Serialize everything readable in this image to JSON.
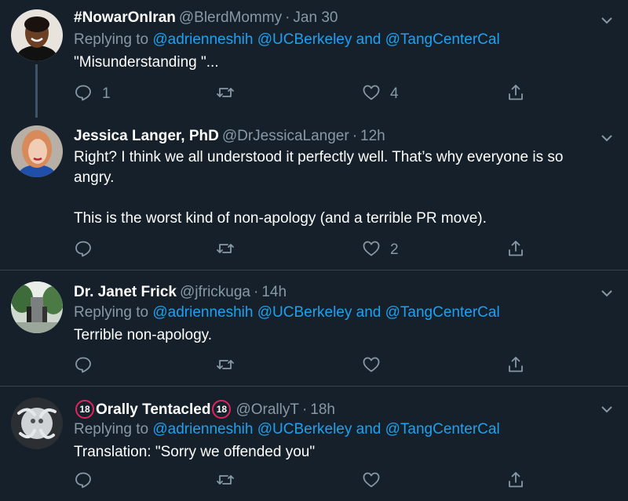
{
  "tweets": [
    {
      "name": "#NowarOnIran",
      "handle": "@BlerdMommy",
      "time": "Jan 30",
      "replying_prefix": "Replying to",
      "replying_to": [
        "@adrienneshih",
        "@UCBerkeley",
        "@TangCenterCal"
      ],
      "replying_and": "and",
      "text": "\"Misunderstanding \"...",
      "replies": "1",
      "likes": "4"
    },
    {
      "name": "Jessica Langer, PhD",
      "handle": "@DrJessicaLanger",
      "time": "12h",
      "text_line1": "Right? I think we all understood it perfectly well. That’s why everyone is so angry.",
      "text_line2": "This is the worst kind of non-apology (and a terrible PR move).",
      "likes": "2"
    },
    {
      "name": "Dr. Janet Frick",
      "handle": "@jfrickuga",
      "time": "14h",
      "replying_prefix": "Replying to",
      "replying_to": [
        "@adrienneshih",
        "@UCBerkeley",
        "@TangCenterCal"
      ],
      "replying_and": "and",
      "text": "Terrible non-apology."
    },
    {
      "name": "Orally Tentacled",
      "badge": "18",
      "handle": "@OrallyT",
      "time": "18h",
      "replying_prefix": "Replying to",
      "replying_to": [
        "@adrienneshih",
        "@UCBerkeley",
        "@TangCenterCal"
      ],
      "replying_and": "and",
      "text": "Translation: \"Sorry we offended you\""
    }
  ],
  "separator": "·",
  "icons": {
    "reply": "reply-icon",
    "retweet": "retweet-icon",
    "like": "heart-icon",
    "share": "share-icon",
    "menu": "chevron-down-icon"
  },
  "colors": {
    "background": "#15202b",
    "secondary_text": "#8899a6",
    "link": "#1da1f2",
    "divider": "#38444d"
  }
}
